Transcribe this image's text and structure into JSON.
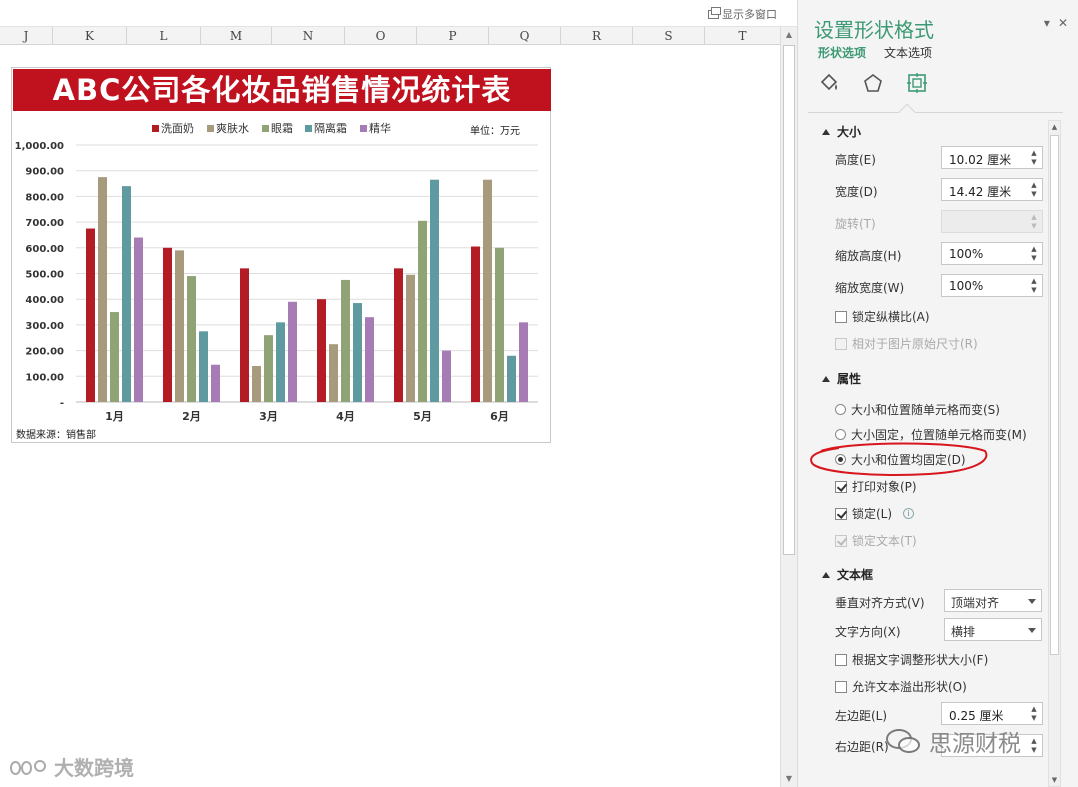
{
  "topbar": {
    "multi_window_label": "显示多窗口"
  },
  "columns": [
    "J",
    "K",
    "L",
    "M",
    "N",
    "O",
    "P",
    "Q",
    "R",
    "S",
    "T"
  ],
  "chart_data": {
    "type": "bar",
    "title": "ABC公司各化妆品销售情况统计表",
    "unit_label": "单位：万元",
    "source_label": "数据来源：销售部",
    "categories": [
      "1月",
      "2月",
      "3月",
      "4月",
      "5月",
      "6月"
    ],
    "ylim": [
      0,
      1000
    ],
    "yticks": [
      "-",
      "100.00",
      "200.00",
      "300.00",
      "400.00",
      "500.00",
      "600.00",
      "700.00",
      "800.00",
      "900.00",
      "1,000.00"
    ],
    "grid": true,
    "legend_position": "top",
    "series": [
      {
        "name": "洗面奶",
        "color": "#b31b25",
        "values": [
          675,
          600,
          520,
          400,
          520,
          605
        ]
      },
      {
        "name": "爽肤水",
        "color": "#a89a7c",
        "values": [
          875,
          590,
          140,
          225,
          495,
          865
        ]
      },
      {
        "name": "眼霜",
        "color": "#8fa374",
        "values": [
          350,
          490,
          260,
          475,
          705,
          600
        ]
      },
      {
        "name": "隔离霜",
        "color": "#5f9aa0",
        "values": [
          840,
          275,
          310,
          385,
          865,
          180
        ]
      },
      {
        "name": "精华",
        "color": "#a77cb5",
        "values": [
          640,
          145,
          390,
          330,
          200,
          310
        ]
      }
    ]
  },
  "pane": {
    "title": "设置形状格式",
    "tabs": [
      {
        "label": "形状选项",
        "active": true
      },
      {
        "label": "文本选项",
        "active": false
      }
    ],
    "icons": [
      "fill-bucket-icon",
      "pentagon-icon",
      "size-properties-icon"
    ],
    "size_section": {
      "header": "大小",
      "height_label": "高度(E)",
      "height_value": "10.02 厘米",
      "width_label": "宽度(D)",
      "width_value": "14.42 厘米",
      "rotation_label": "旋转(T)",
      "rotation_value": "",
      "scale_h_label": "缩放高度(H)",
      "scale_h_value": "100%",
      "scale_w_label": "缩放宽度(W)",
      "scale_w_value": "100%",
      "lock_ratio_label": "锁定纵横比(A)",
      "relative_label": "相对于图片原始尺寸(R)"
    },
    "props_section": {
      "header": "属性",
      "radio1": "大小和位置随单元格而变(S)",
      "radio2": "大小固定，位置随单元格而变(M)",
      "radio3": "大小和位置均固定(D)",
      "print_label": "打印对象(P)",
      "lock_label": "锁定(L)",
      "lock_text_label": "锁定文本(T)"
    },
    "textbox_section": {
      "header": "文本框",
      "valign_label": "垂直对齐方式(V)",
      "valign_value": "顶端对齐",
      "direction_label": "文字方向(X)",
      "direction_value": "横排",
      "autofit_label": "根据文字调整形状大小(F)",
      "overflow_label": "允许文本溢出形状(O)",
      "left_margin_label": "左边距(L)",
      "left_margin_value": "0.25 厘米",
      "right_margin_label": "右边距(R)"
    }
  },
  "watermarks": {
    "left": "大数跨境",
    "right": "思源财税"
  }
}
